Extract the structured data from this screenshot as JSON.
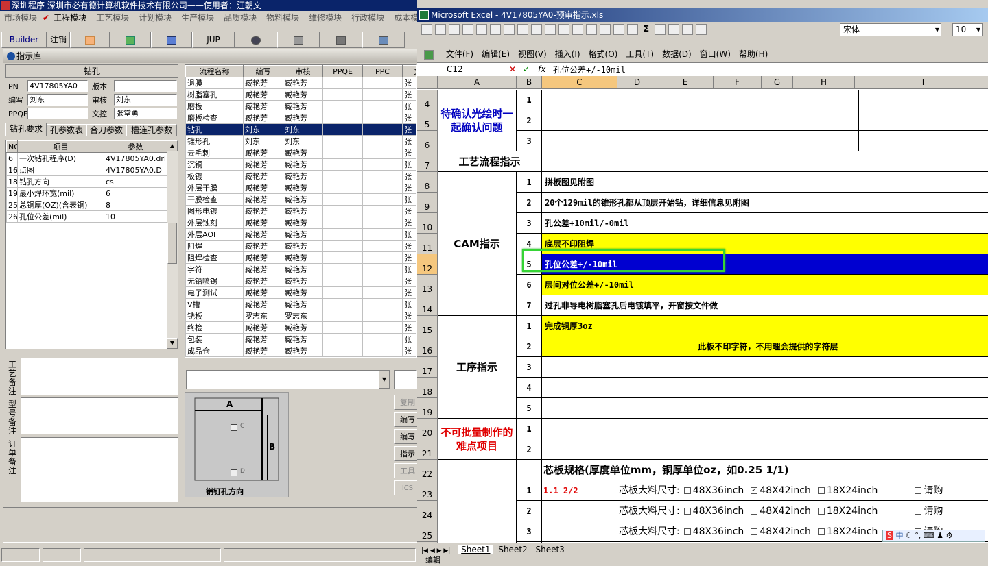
{
  "left_app": {
    "title": "深圳程序   深圳市必有德计算机软件技术有限公司——使用者：汪朝文",
    "menu": [
      "市场模块",
      "工程模块",
      "工艺模块",
      "计划模块",
      "生产模块",
      "品质模块",
      "物料模块",
      "维修模块",
      "行政模块",
      "成本模"
    ],
    "toolbar": {
      "builder": "Builder",
      "logout": "注销",
      "jup": "JUP"
    },
    "panel_title": "指示库",
    "drill_header": "钻孔",
    "fields": {
      "pn_label": "PN",
      "pn_value": "4V17805YA0",
      "version_label": "版本",
      "version_value": "",
      "author_label": "编写",
      "author_value": "刘东",
      "review_label": "审核",
      "review_value": "刘东",
      "ppqe_label": "PPQE",
      "ppqe_value": "",
      "doc_label": "文控",
      "doc_value": "张堂勇"
    },
    "tabs": [
      "钻孔要求",
      "孔参数表",
      "合刀参数",
      "槽连孔参数"
    ],
    "param_table": {
      "headers": [
        "NO",
        "项目",
        "参数"
      ],
      "rows": [
        [
          "6",
          "一次钻孔程序(D)",
          "4V17805YA0.drl"
        ],
        [
          "16",
          "点图",
          "4V17805YA0.D"
        ],
        [
          "18",
          "钻孔方向",
          "cs"
        ],
        [
          "19",
          "最小焊环宽(mil)",
          "6"
        ],
        [
          "25",
          "总铜厚(OZ)(含表铜)",
          "8"
        ],
        [
          "26",
          "孔位公差(mil)",
          "10"
        ]
      ]
    },
    "remarks": [
      "工艺备注",
      "型号备注",
      "订单备注"
    ],
    "process_table": {
      "headers": [
        "流程名称",
        "编写",
        "审核",
        "PPQE",
        "PPC",
        "文"
      ],
      "rows": [
        [
          "退膜",
          "臧艳芳",
          "臧艳芳",
          "",
          "",
          "张"
        ],
        [
          "树脂塞孔",
          "臧艳芳",
          "臧艳芳",
          "",
          "",
          "张"
        ],
        [
          "磨板",
          "臧艳芳",
          "臧艳芳",
          "",
          "",
          "张"
        ],
        [
          "磨板检查",
          "臧艳芳",
          "臧艳芳",
          "",
          "",
          "张"
        ],
        [
          "钻孔",
          "刘东",
          "刘东",
          "",
          "",
          "张"
        ],
        [
          "锥形孔",
          "刘东",
          "刘东",
          "",
          "",
          "张"
        ],
        [
          "去毛刺",
          "臧艳芳",
          "臧艳芳",
          "",
          "",
          "张"
        ],
        [
          "沉铜",
          "臧艳芳",
          "臧艳芳",
          "",
          "",
          "张"
        ],
        [
          "板镀",
          "臧艳芳",
          "臧艳芳",
          "",
          "",
          "张"
        ],
        [
          "外层干膜",
          "臧艳芳",
          "臧艳芳",
          "",
          "",
          "张"
        ],
        [
          "干膜检查",
          "臧艳芳",
          "臧艳芳",
          "",
          "",
          "张"
        ],
        [
          "图形电镀",
          "臧艳芳",
          "臧艳芳",
          "",
          "",
          "张"
        ],
        [
          "外层蚀刻",
          "臧艳芳",
          "臧艳芳",
          "",
          "",
          "张"
        ],
        [
          "外层AOI",
          "臧艳芳",
          "臧艳芳",
          "",
          "",
          "张"
        ],
        [
          "阻焊",
          "臧艳芳",
          "臧艳芳",
          "",
          "",
          "张"
        ],
        [
          "阻焊检查",
          "臧艳芳",
          "臧艳芳",
          "",
          "",
          "张"
        ],
        [
          "字符",
          "臧艳芳",
          "臧艳芳",
          "",
          "",
          "张"
        ],
        [
          "无铅喷锡",
          "臧艳芳",
          "臧艳芳",
          "",
          "",
          "张"
        ],
        [
          "电子测试",
          "臧艳芳",
          "臧艳芳",
          "",
          "",
          "张"
        ],
        [
          "V槽",
          "臧艳芳",
          "臧艳芳",
          "",
          "",
          "张"
        ],
        [
          "铣板",
          "罗志东",
          "罗志东",
          "",
          "",
          "张"
        ],
        [
          "终检",
          "臧艳芳",
          "臧艳芳",
          "",
          "",
          "张"
        ],
        [
          "包装",
          "臧艳芳",
          "臧艳芳",
          "",
          "",
          "张"
        ],
        [
          "成品仓",
          "臧艳芳",
          "臧艳芳",
          "",
          "",
          "张"
        ]
      ],
      "selected_index": 4
    },
    "pin_diagram": {
      "a": "A",
      "b": "B",
      "c": "C",
      "d": "D",
      "caption": "销钉孔方向"
    },
    "side_buttons": [
      "复制",
      "编写",
      "编写",
      "指示",
      "工具",
      "ICS"
    ]
  },
  "excel": {
    "title": "Microsoft Excel - 4V17805YA0-预审指示.xls",
    "font_name": "宋体",
    "font_size": "10",
    "menu": [
      "文件(F)",
      "编辑(E)",
      "视图(V)",
      "插入(I)",
      "格式(O)",
      "工具(T)",
      "数据(D)",
      "窗口(W)",
      "帮助(H)"
    ],
    "name_box": "C12",
    "formula": "孔位公差+/-10mil",
    "columns": [
      "A",
      "B",
      "C",
      "D",
      "E",
      "F",
      "G",
      "H",
      "I"
    ],
    "sections": {
      "confirm": "待确认光绘时一起确认问题",
      "process_flow": "工艺流程指示",
      "cam": "CAM指示",
      "procedure": "工序指示",
      "difficult": "不可批量制作的难点项目"
    },
    "cam_items": [
      "拼板图见附图",
      "20个129mil的锥形孔都从顶层开始钻，详细信息见附图",
      "孔公差+10mil/-0mil",
      "底层不印阻焊",
      "孔位公差+/-10mil",
      "层间对位公差+/-10mil",
      "过孔非导电树脂塞孔后电镀填平，开窗按文件做"
    ],
    "procedure_items": [
      "完成铜厚3oz",
      "此板不印字符，不用理会提供的字符层",
      "",
      "",
      ""
    ],
    "core_spec_title": "芯板规格(厚度单位mm，铜厚单位oz，如0.25 1/1)",
    "core_first_value": "1.1 2/2",
    "core_label": "芯板大料尺寸:",
    "core_options": [
      "48X36inch",
      "48X42inch",
      "18X24inch",
      "请购"
    ],
    "sheet_tabs": [
      "Sheet1",
      "Sheet2",
      "Sheet3"
    ],
    "status": "编辑",
    "ime": "中"
  }
}
